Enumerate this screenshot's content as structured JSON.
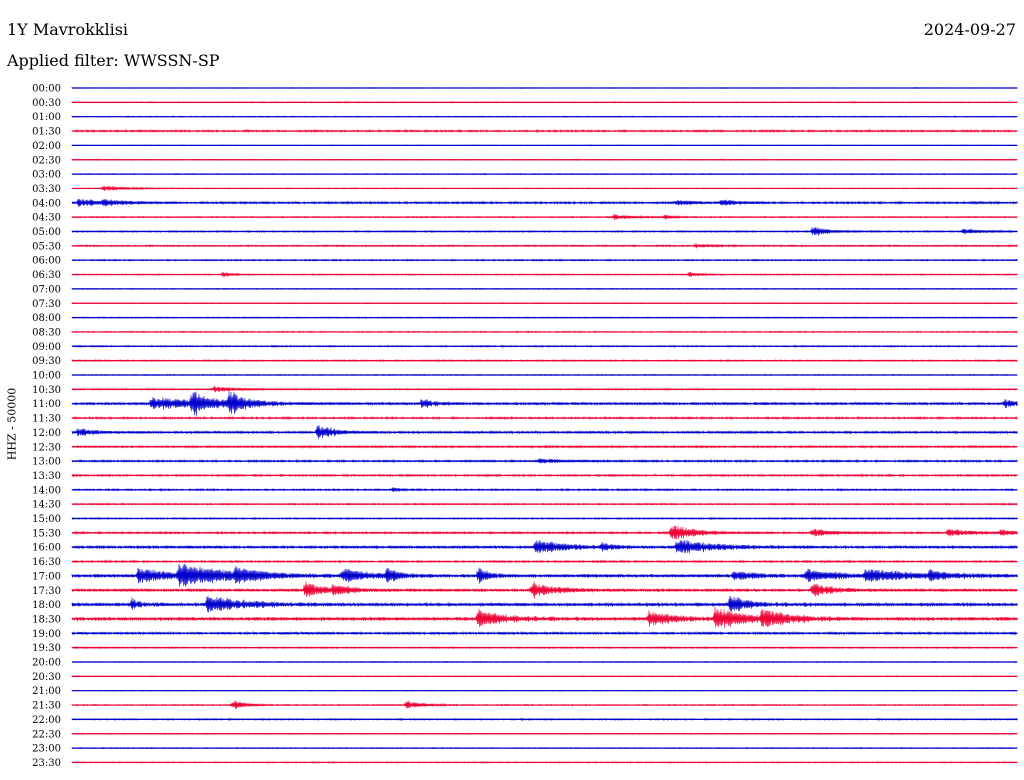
{
  "header": {
    "station": "1Y Mavrokklisi",
    "date": "2024-09-27",
    "filter": "Applied filter: WWSSN-SP"
  },
  "colors": {
    "odd_trace": "#0000cc",
    "even_trace": "#ee0033",
    "text": "#000000"
  },
  "chart_data": {
    "type": "line",
    "title": "1Y Mavrokklisi",
    "subtitle": "Applied filter: WWSSN-SP",
    "date": "2024-09-27",
    "ylabel": "HHZ - 50000",
    "xlabel": "",
    "grid": false,
    "trace_minutes": 30,
    "series_colors": [
      "#0000cc",
      "#ee0033"
    ],
    "rows": [
      "00:00",
      "00:30",
      "01:00",
      "01:30",
      "02:00",
      "02:30",
      "03:00",
      "03:30",
      "04:00",
      "04:30",
      "05:00",
      "05:30",
      "06:00",
      "06:30",
      "07:00",
      "07:30",
      "08:00",
      "08:30",
      "09:00",
      "09:30",
      "10:00",
      "10:30",
      "11:00",
      "11:30",
      "12:00",
      "12:30",
      "13:00",
      "13:30",
      "14:00",
      "14:30",
      "15:00",
      "15:30",
      "16:00",
      "16:30",
      "17:00",
      "17:30",
      "18:00",
      "18:30",
      "19:00",
      "19:30",
      "20:00",
      "20:30",
      "21:00",
      "21:30",
      "22:00",
      "22:30",
      "23:00",
      "23:30"
    ],
    "noise_level": [
      0.3,
      0.4,
      0.4,
      0.8,
      0.3,
      0.4,
      0.4,
      0.4,
      0.9,
      0.5,
      0.6,
      0.6,
      0.6,
      0.5,
      0.4,
      0.4,
      0.5,
      0.5,
      0.6,
      0.6,
      0.4,
      0.6,
      1.2,
      0.8,
      1.0,
      0.8,
      0.8,
      0.8,
      0.7,
      0.6,
      0.6,
      0.8,
      1.3,
      0.8,
      1.5,
      1.3,
      1.6,
      1.6,
      1.0,
      0.6,
      0.4,
      0.4,
      0.3,
      0.5,
      0.6,
      0.4,
      0.4,
      0.5
    ],
    "events": [
      {
        "row": "03:30",
        "t": 0.98,
        "amp": 3,
        "dur": 1.2
      },
      {
        "row": "04:00",
        "t": 0.2,
        "amp": 4,
        "dur": 1.4
      },
      {
        "row": "04:00",
        "t": 1.0,
        "amp": 3,
        "dur": 1.0
      },
      {
        "row": "04:00",
        "t": 19.2,
        "amp": 3,
        "dur": 1.0
      },
      {
        "row": "04:00",
        "t": 20.6,
        "amp": 3,
        "dur": 1.0
      },
      {
        "row": "04:30",
        "t": 17.2,
        "amp": 3,
        "dur": 0.9
      },
      {
        "row": "04:30",
        "t": 18.8,
        "amp": 2,
        "dur": 0.6
      },
      {
        "row": "05:00",
        "t": 23.5,
        "amp": 5,
        "dur": 0.9
      },
      {
        "row": "05:00",
        "t": 28.3,
        "amp": 3,
        "dur": 1.0
      },
      {
        "row": "05:30",
        "t": 19.8,
        "amp": 2,
        "dur": 0.8
      },
      {
        "row": "06:30",
        "t": 4.8,
        "amp": 3,
        "dur": 0.4
      },
      {
        "row": "06:30",
        "t": 19.6,
        "amp": 3,
        "dur": 0.5
      },
      {
        "row": "10:30",
        "t": 4.5,
        "amp": 3,
        "dur": 1.2
      },
      {
        "row": "11:00",
        "t": 2.5,
        "amp": 6,
        "dur": 3.2
      },
      {
        "row": "11:00",
        "t": 3.8,
        "amp": 12,
        "dur": 0.8
      },
      {
        "row": "11:00",
        "t": 5.0,
        "amp": 12,
        "dur": 0.8
      },
      {
        "row": "11:00",
        "t": 11.1,
        "amp": 5,
        "dur": 0.6
      },
      {
        "row": "11:00",
        "t": 29.6,
        "amp": 4,
        "dur": 0.6
      },
      {
        "row": "12:00",
        "t": 0.2,
        "amp": 4,
        "dur": 0.9
      },
      {
        "row": "12:00",
        "t": 7.8,
        "amp": 8,
        "dur": 0.9
      },
      {
        "row": "13:00",
        "t": 14.8,
        "amp": 2,
        "dur": 2.0
      },
      {
        "row": "14:00",
        "t": 10.2,
        "amp": 3,
        "dur": 0.3
      },
      {
        "row": "15:30",
        "t": 19.0,
        "amp": 9,
        "dur": 1.3
      },
      {
        "row": "15:30",
        "t": 23.5,
        "amp": 4,
        "dur": 1.2
      },
      {
        "row": "15:30",
        "t": 27.8,
        "amp": 4,
        "dur": 1.5
      },
      {
        "row": "15:30",
        "t": 29.5,
        "amp": 4,
        "dur": 0.6
      },
      {
        "row": "16:00",
        "t": 14.7,
        "amp": 9,
        "dur": 1.4
      },
      {
        "row": "16:00",
        "t": 16.8,
        "amp": 4,
        "dur": 0.6
      },
      {
        "row": "16:00",
        "t": 19.2,
        "amp": 8,
        "dur": 1.8
      },
      {
        "row": "17:00",
        "t": 2.1,
        "amp": 8,
        "dur": 1.8
      },
      {
        "row": "17:00",
        "t": 3.4,
        "amp": 11,
        "dur": 2.6
      },
      {
        "row": "17:00",
        "t": 5.2,
        "amp": 7,
        "dur": 1.0
      },
      {
        "row": "17:00",
        "t": 8.6,
        "amp": 8,
        "dur": 1.2
      },
      {
        "row": "17:00",
        "t": 10.0,
        "amp": 7,
        "dur": 0.6
      },
      {
        "row": "17:00",
        "t": 12.9,
        "amp": 8,
        "dur": 0.6
      },
      {
        "row": "17:00",
        "t": 21.0,
        "amp": 6,
        "dur": 1.0
      },
      {
        "row": "17:00",
        "t": 23.3,
        "amp": 7,
        "dur": 1.4
      },
      {
        "row": "17:00",
        "t": 25.2,
        "amp": 7,
        "dur": 2.2
      },
      {
        "row": "17:00",
        "t": 27.2,
        "amp": 5,
        "dur": 1.2
      },
      {
        "row": "17:30",
        "t": 7.4,
        "amp": 8,
        "dur": 1.0
      },
      {
        "row": "17:30",
        "t": 8.3,
        "amp": 5,
        "dur": 0.8
      },
      {
        "row": "17:30",
        "t": 14.6,
        "amp": 8,
        "dur": 1.2
      },
      {
        "row": "17:30",
        "t": 23.5,
        "amp": 7,
        "dur": 1.0
      },
      {
        "row": "18:00",
        "t": 1.9,
        "amp": 6,
        "dur": 0.4
      },
      {
        "row": "18:00",
        "t": 4.3,
        "amp": 9,
        "dur": 1.8
      },
      {
        "row": "18:00",
        "t": 20.9,
        "amp": 9,
        "dur": 1.0
      },
      {
        "row": "18:30",
        "t": 12.9,
        "amp": 9,
        "dur": 1.3
      },
      {
        "row": "18:30",
        "t": 18.3,
        "amp": 8,
        "dur": 1.2
      },
      {
        "row": "18:30",
        "t": 20.4,
        "amp": 11,
        "dur": 1.6
      },
      {
        "row": "18:30",
        "t": 21.9,
        "amp": 9,
        "dur": 1.3
      },
      {
        "row": "21:30",
        "t": 5.1,
        "amp": 6,
        "dur": 0.6
      },
      {
        "row": "21:30",
        "t": 10.6,
        "amp": 5,
        "dur": 0.8
      }
    ]
  }
}
